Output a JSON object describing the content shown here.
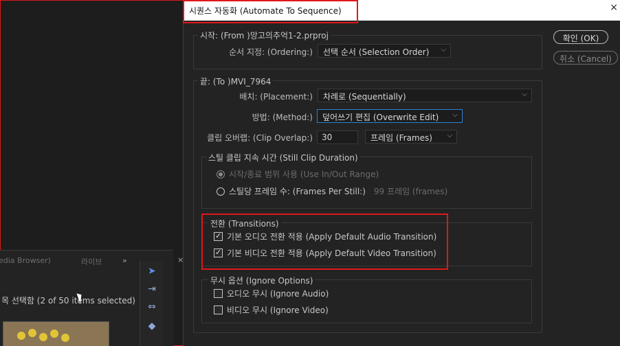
{
  "background": {
    "tabs": [
      "edia Browser)",
      "라이브",
      "»"
    ],
    "status": "목 선택함 (2 of 50 items selected)",
    "close": "×"
  },
  "dialog": {
    "title": "시퀀스 자동화 (Automate To Sequence)",
    "close": "×",
    "from": {
      "label": "시작: (From )망고의추억1-2.prproj",
      "ordering_label": "순서 지정: (Ordering:)",
      "ordering_value": "선택 순서 (Selection Order)"
    },
    "to": {
      "label": "끝: (To )MVI_7964",
      "placement_label": "배치: (Placement:)",
      "placement_value": "차례로 (Sequentially)",
      "method_label": "방법: (Method:)",
      "method_value": "덮어쓰기 편집 (Overwrite Edit)",
      "overlap_label": "클립 오버랩: (Clip Overlap:)",
      "overlap_value": "30",
      "overlap_unit": "프레임 (Frames)"
    },
    "still": {
      "label": "스틸 클립 지속 시간 (Still Clip Duration)",
      "option1": "시작/종료 범위 사용 (Use In/Out Range)",
      "option2": "스틸당 프레임 수: (Frames Per Still:)",
      "frames_value": "99 프레임 (frames)"
    },
    "transitions": {
      "label": "전환 (Transitions)",
      "audio": "기본 오디오 전환 적용 (Apply Default Audio Transition)",
      "video": "기본 비디오 전환 적용 (Apply Default Video Transition)"
    },
    "ignore": {
      "label": "무시 옵션 (Ignore Options)",
      "audio": "오디오 무시 (Ignore Audio)",
      "video": "비디오 무시 (Ignore Video)"
    },
    "ok": "확인 (OK)",
    "cancel": "취소 (Cancel)"
  },
  "colors": {
    "highlight": "#e01818",
    "focus": "#2f7fd8"
  },
  "icons": [
    "close-icon",
    "chevron-down-icon",
    "selection-tool-icon",
    "track-select-icon",
    "ripple-edit-icon",
    "razor-icon"
  ]
}
